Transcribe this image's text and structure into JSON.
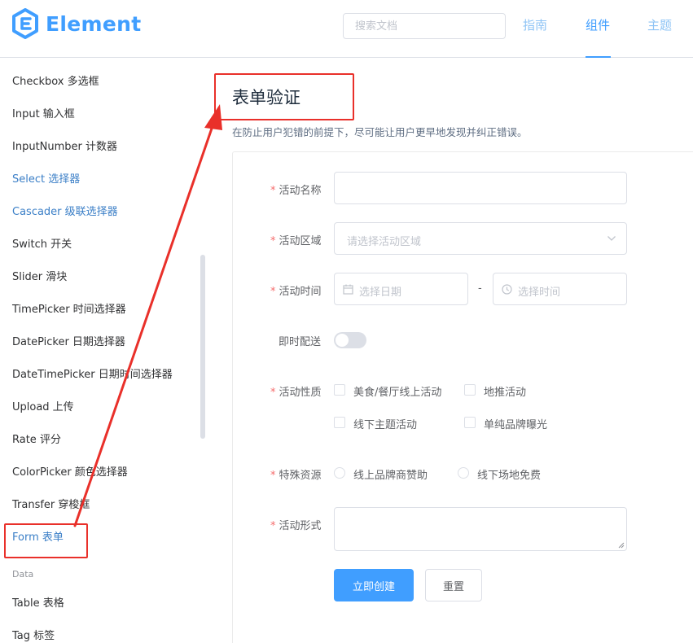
{
  "header": {
    "logo_text": "Element",
    "search_placeholder": "搜索文档",
    "nav": [
      {
        "label": "指南",
        "active": false
      },
      {
        "label": "组件",
        "active": true
      },
      {
        "label": "主题",
        "active": false
      }
    ],
    "accent": "#409eff"
  },
  "sidebar": {
    "items": [
      {
        "label": "Checkbox 多选框"
      },
      {
        "label": "Input 输入框"
      },
      {
        "label": "InputNumber 计数器"
      },
      {
        "label": "Select 选择器"
      },
      {
        "label": "Cascader 级联选择器"
      },
      {
        "label": "Switch 开关"
      },
      {
        "label": "Slider 滑块"
      },
      {
        "label": "TimePicker 时间选择器"
      },
      {
        "label": "DatePicker 日期选择器"
      },
      {
        "label": "DateTimePicker 日期时间选择器"
      },
      {
        "label": "Upload 上传"
      },
      {
        "label": "Rate 评分"
      },
      {
        "label": "ColorPicker 颜色选择器"
      },
      {
        "label": "Transfer 穿梭框"
      },
      {
        "label": "Form 表单"
      }
    ],
    "group_data": "Data",
    "data_items": [
      {
        "label": "Table 表格"
      },
      {
        "label": "Tag 标签"
      }
    ]
  },
  "main": {
    "title": "表单验证",
    "description": "在防止用户犯错的前提下，尽可能让用户更早地发现并纠正错误。"
  },
  "form": {
    "name_label": "活动名称",
    "name_value": "",
    "region_label": "活动区域",
    "region_placeholder": "请选择活动区域",
    "time_label": "活动时间",
    "date_placeholder": "选择日期",
    "date_separator": "-",
    "time_placeholder": "选择时间",
    "delivery_label": "即时配送",
    "delivery_on": false,
    "type_label": "活动性质",
    "type_options": [
      "美食/餐厅线上活动",
      "地推活动",
      "线下主题活动",
      "单纯品牌曝光"
    ],
    "resource_label": "特殊资源",
    "resource_options": [
      "线上品牌商赞助",
      "线下场地免费"
    ],
    "desc_label": "活动形式",
    "desc_value": "",
    "submit_label": "立即创建",
    "reset_label": "重置"
  },
  "icons": {
    "logo": "element-logo-icon",
    "dropdown": "chevron-down-icon",
    "calendar": "calendar-icon",
    "clock": "clock-icon"
  }
}
